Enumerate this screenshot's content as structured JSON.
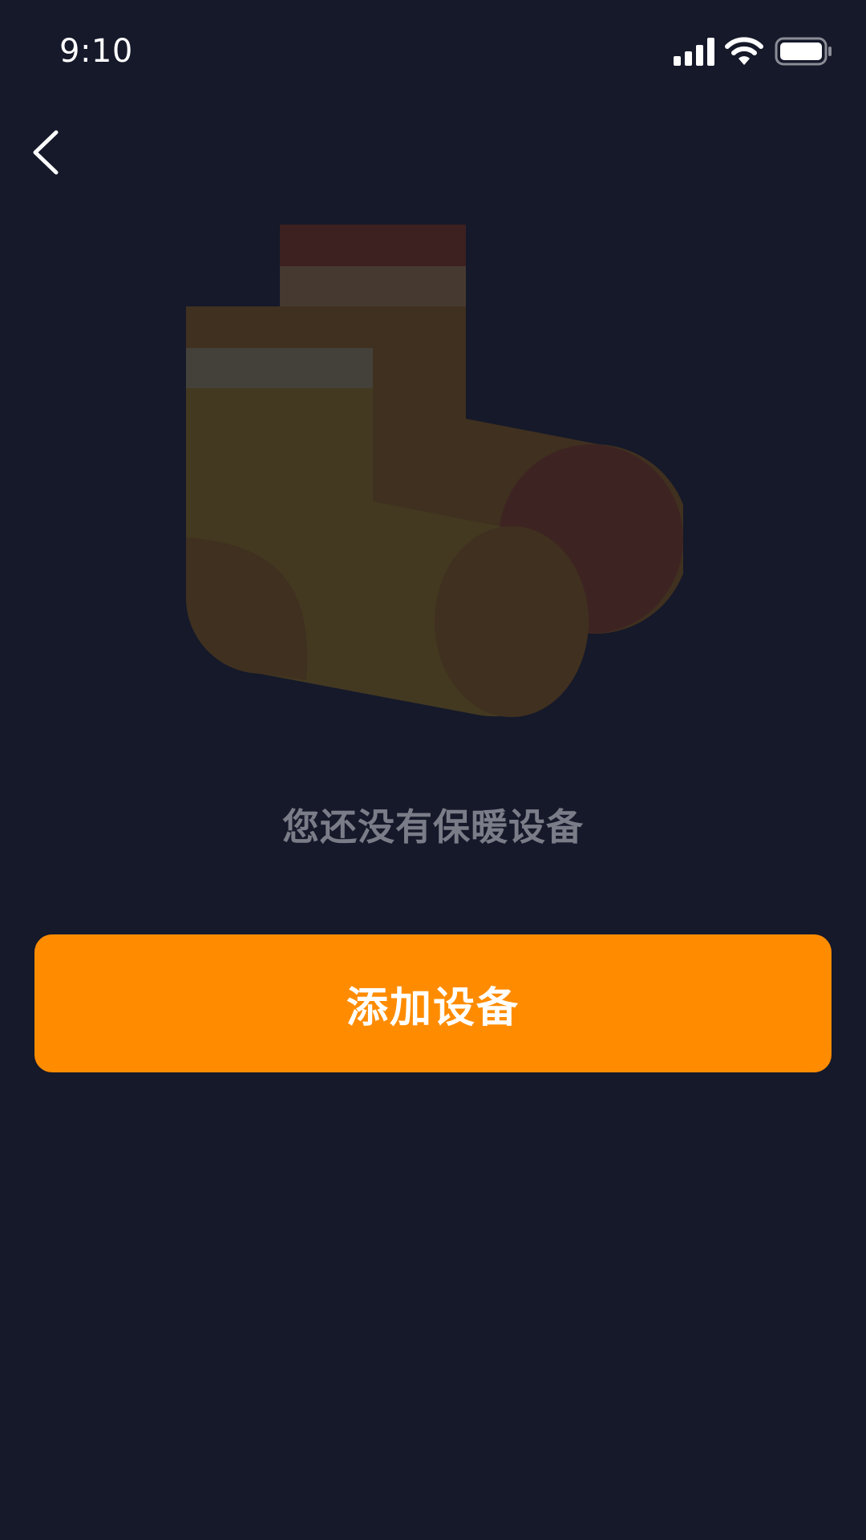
{
  "status_bar": {
    "time": "9:10"
  },
  "icons": {
    "back": "chevron-left-icon",
    "signal": "cellular-signal-icon",
    "wifi": "wifi-icon",
    "battery": "battery-icon",
    "illustration": "socks-icon"
  },
  "empty_state": {
    "message": "您还没有保暖设备"
  },
  "actions": {
    "add_device_label": "添加设备"
  },
  "colors": {
    "background": "#15192a",
    "accent": "#ff8c00",
    "message_text": "#7a7d88"
  }
}
